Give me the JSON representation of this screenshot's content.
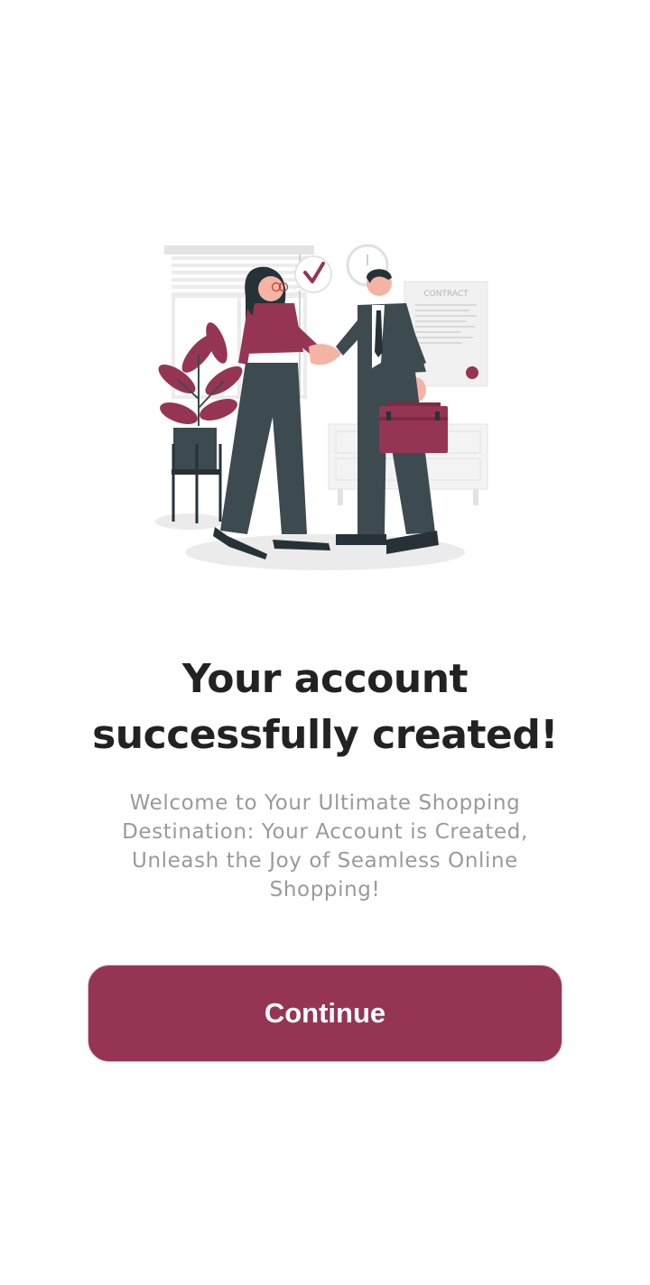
{
  "illustration": {
    "contract_label": "CONTRACT",
    "accent_color": "#963553",
    "dark_color": "#3d4a50"
  },
  "title": "Your account successfully created!",
  "subtitle": "Welcome to Your Ultimate Shopping Destination: Your Account is Created, Unleash the Joy of Seamless Online Shopping!",
  "button": {
    "label": "Continue",
    "color": "#963553"
  }
}
